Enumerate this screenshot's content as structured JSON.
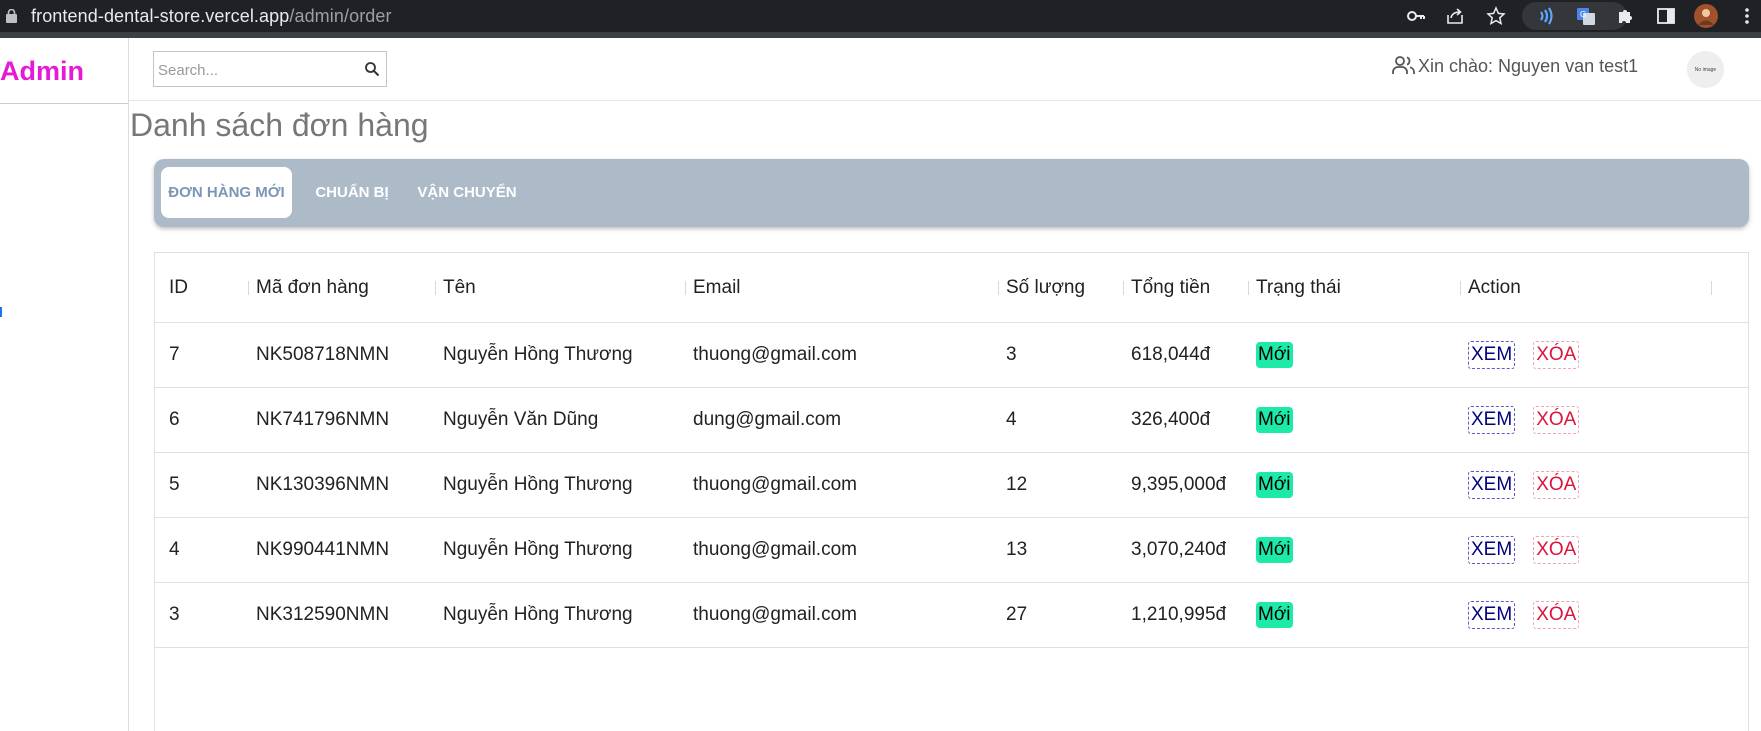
{
  "browser": {
    "url_host": "frontend-dental-store.vercel.app",
    "url_path": "/admin/order"
  },
  "sidebar": {
    "brand": "Admin"
  },
  "header": {
    "search_placeholder": "Search...",
    "greeting": "Xin chào: Nguyen van test1",
    "avatar_text": "No image"
  },
  "page": {
    "title": "Danh sách đơn hàng"
  },
  "tabs": [
    {
      "label": "ĐƠN HÀNG MỚI",
      "active": true
    },
    {
      "label": "CHUẨN BỊ",
      "active": false
    },
    {
      "label": "VẬN CHUYỂN",
      "active": false
    }
  ],
  "table": {
    "columns": [
      "ID",
      "Mã đơn hàng",
      "Tên",
      "Email",
      "Số lượng",
      "Tổng tiền",
      "Trạng thái",
      "Action"
    ],
    "rows": [
      {
        "id": "7",
        "code": "NK508718NMN",
        "name": "Nguyễn Hồng Thương",
        "email": "thuong@gmail.com",
        "qty": "3",
        "total": "618,044đ",
        "status": "Mới",
        "view": "XEM",
        "delete": "XÓA"
      },
      {
        "id": "6",
        "code": "NK741796NMN",
        "name": "Nguyễn Văn Dũng",
        "email": "dung@gmail.com",
        "qty": "4",
        "total": "326,400đ",
        "status": "Mới",
        "view": "XEM",
        "delete": "XÓA"
      },
      {
        "id": "5",
        "code": "NK130396NMN",
        "name": "Nguyễn Hồng Thương",
        "email": "thuong@gmail.com",
        "qty": "12",
        "total": "9,395,000đ",
        "status": "Mới",
        "view": "XEM",
        "delete": "XÓA"
      },
      {
        "id": "4",
        "code": "NK990441NMN",
        "name": "Nguyễn Hồng Thương",
        "email": "thuong@gmail.com",
        "qty": "13",
        "total": "3,070,240đ",
        "status": "Mới",
        "view": "XEM",
        "delete": "XÓA"
      },
      {
        "id": "3",
        "code": "NK312590NMN",
        "name": "Nguyễn Hồng Thương",
        "email": "thuong@gmail.com",
        "qty": "27",
        "total": "1,210,995đ",
        "status": "Mới",
        "view": "XEM",
        "delete": "XÓA"
      }
    ]
  },
  "colors": {
    "brand": "#e61ad6",
    "tabs_bg": "#adbbc9",
    "status_bg": "#1de9a9",
    "view_text": "#000080",
    "delete_text": "#dc143c"
  }
}
